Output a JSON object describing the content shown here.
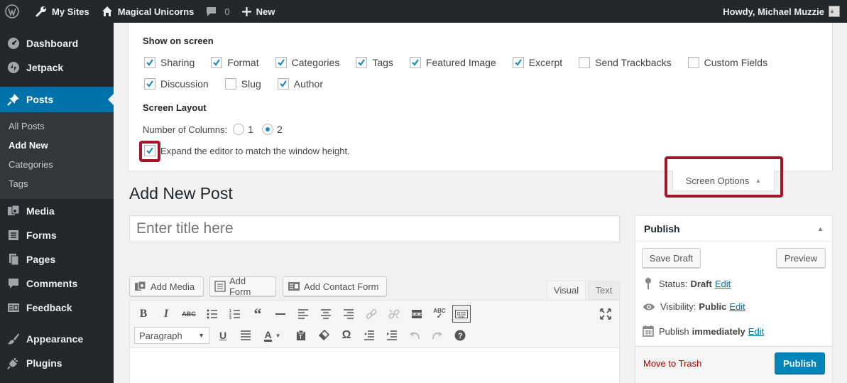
{
  "adminbar": {
    "my_sites": "My Sites",
    "site_name": "Magical Unicorns",
    "comments_count": "0",
    "new_label": "New",
    "greeting": "Howdy, Michael Muzzie"
  },
  "menu": {
    "dashboard": "Dashboard",
    "jetpack": "Jetpack",
    "posts": "Posts",
    "posts_sub": [
      "All Posts",
      "Add New",
      "Categories",
      "Tags"
    ],
    "media": "Media",
    "forms": "Forms",
    "pages": "Pages",
    "comments": "Comments",
    "feedback": "Feedback",
    "appearance": "Appearance",
    "plugins": "Plugins"
  },
  "screen_options": {
    "show_on_screen": "Show on screen",
    "boxes_row1": [
      {
        "label": "Sharing",
        "checked": true
      },
      {
        "label": "Format",
        "checked": true
      },
      {
        "label": "Categories",
        "checked": true
      },
      {
        "label": "Tags",
        "checked": true
      },
      {
        "label": "Featured Image",
        "checked": true
      },
      {
        "label": "Excerpt",
        "checked": true
      },
      {
        "label": "Send Trackbacks",
        "checked": false
      },
      {
        "label": "Custom Fields",
        "checked": false
      }
    ],
    "boxes_row2": [
      {
        "label": "Discussion",
        "checked": true
      },
      {
        "label": "Slug",
        "checked": false
      },
      {
        "label": "Author",
        "checked": true
      }
    ],
    "screen_layout": "Screen Layout",
    "columns_label": "Number of Columns:",
    "column_options": [
      "1",
      "2"
    ],
    "selected_columns": "2",
    "expand_editor_label": "Expand the editor to match the window height.",
    "expand_editor_checked": true,
    "tab_label": "Screen Options"
  },
  "editor": {
    "page_title": "Add New Post",
    "title_placeholder": "Enter title here",
    "add_media": "Add Media",
    "add_form": "Add Form",
    "add_contact_form": "Add Contact Form",
    "tab_visual": "Visual",
    "tab_text": "Text",
    "format_select": "Paragraph"
  },
  "publish": {
    "heading": "Publish",
    "save_draft": "Save Draft",
    "preview": "Preview",
    "status_label": "Status:",
    "status_value": "Draft",
    "visibility_label": "Visibility:",
    "visibility_value": "Public",
    "publish_label": "Publish",
    "publish_value": "immediately",
    "edit": "Edit",
    "move_to_trash": "Move to Trash",
    "publish_button": "Publish"
  },
  "colors": {
    "admin_dark": "#23282d",
    "accent": "#0073aa",
    "highlight": "#a0162a",
    "publish_blue": "#0085ba"
  }
}
